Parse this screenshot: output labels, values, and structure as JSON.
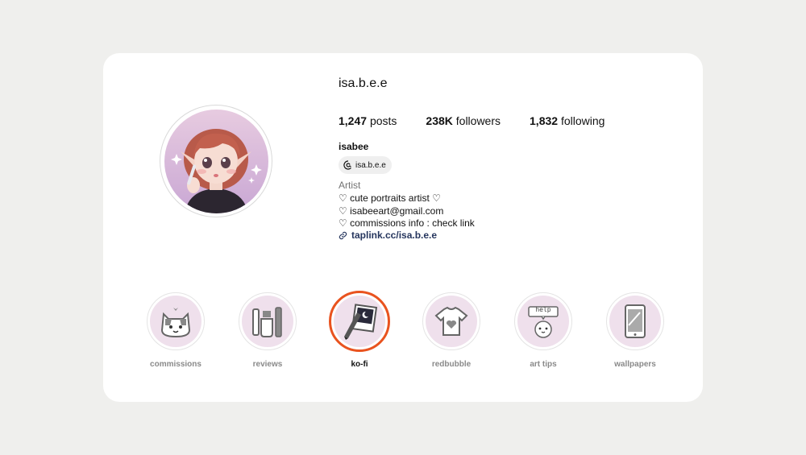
{
  "profile": {
    "username": "isa.b.e.e",
    "stats": {
      "posts_count": "1,247",
      "posts_label": "posts",
      "followers_count": "238K",
      "followers_label": "followers",
      "following_count": "1,832",
      "following_label": "following"
    },
    "display_name": "isabee",
    "threads_handle": "isa.b.e.e",
    "category": "Artist",
    "bio": [
      "♡ cute portraits artist ♡",
      "♡ isabeeart@gmail.com",
      "♡ commissions info : check link"
    ],
    "link": "taplink.cc/isa.b.e.e"
  },
  "highlights": [
    {
      "label": "commissions",
      "icon": "cat-icon",
      "active": false
    },
    {
      "label": "reviews",
      "icon": "art-supplies-icon",
      "active": false
    },
    {
      "label": "ko-fi",
      "icon": "polaroid-pen-icon",
      "active": true
    },
    {
      "label": "redbubble",
      "icon": "tshirt-icon",
      "active": false
    },
    {
      "label": "art tips",
      "icon": "help-ghost-icon",
      "active": false
    },
    {
      "label": "wallpapers",
      "icon": "phone-icon",
      "active": false
    }
  ],
  "highlight_speech_text": "help",
  "colors": {
    "active_ring": "#e9531f",
    "link": "#26365e",
    "highlight_bg": "#efe0ec"
  }
}
